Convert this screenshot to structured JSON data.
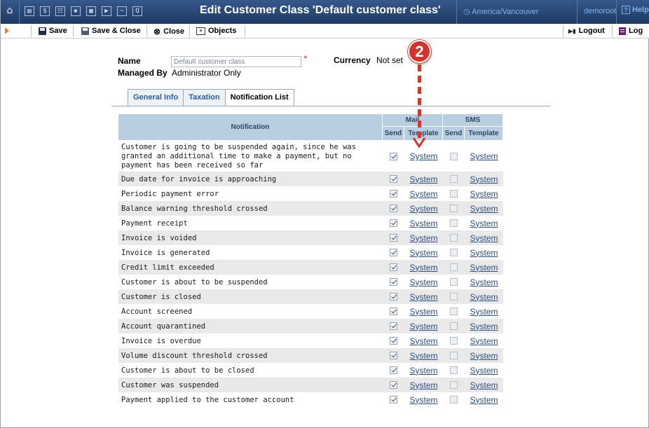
{
  "header": {
    "title": "Edit Customer Class 'Default customer class'",
    "timezone": "America/Vancouver",
    "user": "demoroot",
    "help_label": "Help",
    "help_icon_glyph": "?",
    "home_icon_glyph": "⌂",
    "nav_icons": [
      {
        "name": "customers-icon",
        "glyph": "▤"
      },
      {
        "name": "finance-icon",
        "glyph": "$"
      },
      {
        "name": "routing-icon",
        "glyph": "☷"
      },
      {
        "name": "users-icon",
        "glyph": "✱"
      },
      {
        "name": "tariffs-icon",
        "glyph": "▦"
      },
      {
        "name": "dispatch-icon",
        "glyph": "▶"
      },
      {
        "name": "statistics-icon",
        "glyph": "~"
      },
      {
        "name": "search-icon",
        "glyph": "Q"
      }
    ]
  },
  "toolbar": {
    "save_label": "Save",
    "save_close_label": "Save & Close",
    "close_label": "Close",
    "objects_label": "Objects",
    "logout_label": "Logout",
    "log_label": "Log",
    "close_glyph": "⊗",
    "objects_glyph": "≡",
    "logout_glyph": "▶▮"
  },
  "form": {
    "name_label": "Name",
    "name_value": "Default customer class",
    "required_mark": "*",
    "currency_label": "Currency",
    "currency_value": "Not set",
    "managed_by_label": "Managed By",
    "managed_by_value": "Administrator Only"
  },
  "tabs": [
    {
      "label": "General Info",
      "active": false
    },
    {
      "label": "Taxation",
      "active": false
    },
    {
      "label": "Notification List",
      "active": true
    }
  ],
  "table": {
    "col_notification": "Notification",
    "group_mail": "Mail",
    "group_sms": "SMS",
    "col_send": "Send",
    "col_template": "Template",
    "rows": [
      {
        "text": "Customer is going to be suspended again, since he was granted an additional time to make a payment, but no payment has been received so far",
        "mail_send": true,
        "mail_template": "System",
        "sms_send": false,
        "sms_template": "System"
      },
      {
        "text": "Due date for invoice is approaching",
        "mail_send": true,
        "mail_template": "System",
        "sms_send": false,
        "sms_template": "System"
      },
      {
        "text": "Periodic payment error",
        "mail_send": true,
        "mail_template": "System",
        "sms_send": false,
        "sms_template": "System"
      },
      {
        "text": "Balance warning threshold crossed",
        "mail_send": true,
        "mail_template": "System",
        "sms_send": false,
        "sms_template": "System"
      },
      {
        "text": "Payment receipt",
        "mail_send": true,
        "mail_template": "System",
        "sms_send": false,
        "sms_template": "System"
      },
      {
        "text": "Invoice is voided",
        "mail_send": true,
        "mail_template": "System",
        "sms_send": false,
        "sms_template": "System"
      },
      {
        "text": "Invoice is generated",
        "mail_send": true,
        "mail_template": "System",
        "sms_send": false,
        "sms_template": "System"
      },
      {
        "text": "Credit limit exceeded",
        "mail_send": true,
        "mail_template": "System",
        "sms_send": false,
        "sms_template": "System"
      },
      {
        "text": "Customer is about to be suspended",
        "mail_send": true,
        "mail_template": "System",
        "sms_send": false,
        "sms_template": "System"
      },
      {
        "text": "Customer is closed",
        "mail_send": true,
        "mail_template": "System",
        "sms_send": false,
        "sms_template": "System"
      },
      {
        "text": "Account screened",
        "mail_send": true,
        "mail_template": "System",
        "sms_send": false,
        "sms_template": "System"
      },
      {
        "text": "Account quarantined",
        "mail_send": true,
        "mail_template": "System",
        "sms_send": false,
        "sms_template": "System"
      },
      {
        "text": "Invoice is overdue",
        "mail_send": true,
        "mail_template": "System",
        "sms_send": false,
        "sms_template": "System"
      },
      {
        "text": "Volume discount threshold crossed",
        "mail_send": true,
        "mail_template": "System",
        "sms_send": false,
        "sms_template": "System"
      },
      {
        "text": "Customer is about to be closed",
        "mail_send": true,
        "mail_template": "System",
        "sms_send": false,
        "sms_template": "System"
      },
      {
        "text": "Customer was suspended",
        "mail_send": true,
        "mail_template": "System",
        "sms_send": false,
        "sms_template": "System"
      },
      {
        "text": "Payment applied to the customer account",
        "mail_send": true,
        "mail_template": "System",
        "sms_send": false,
        "sms_template": "System"
      }
    ]
  },
  "annotation": {
    "marker_number": "2"
  },
  "colors": {
    "header_bg": "#28426b",
    "table_header_bg": "#b9cee1",
    "link": "#2a4f86",
    "annotation": "#d0342c"
  }
}
